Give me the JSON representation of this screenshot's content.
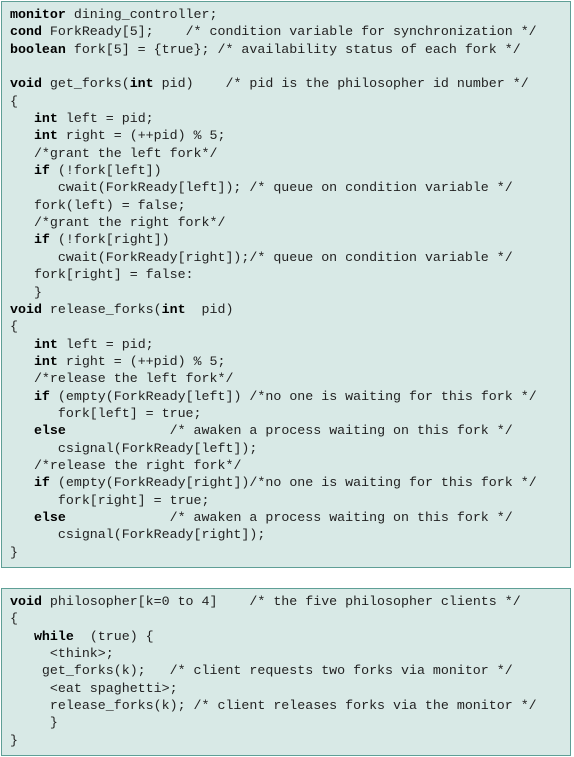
{
  "monitor_block": {
    "lines": [
      [
        {
          "t": "monitor",
          "k": "kw"
        },
        {
          "t": " dining_controller;"
        }
      ],
      [
        {
          "t": "cond",
          "k": "kw"
        },
        {
          "t": " ForkReady[5];    "
        },
        {
          "t": "/* condition variable for synchronization */",
          "k": "cm"
        }
      ],
      [
        {
          "t": "boolean",
          "k": "kw"
        },
        {
          "t": " fork[5] = {true}; "
        },
        {
          "t": "/* availability status of each fork */",
          "k": "cm"
        }
      ],
      [
        {
          "t": ""
        }
      ],
      [
        {
          "t": "void",
          "k": "kw"
        },
        {
          "t": " get_forks("
        },
        {
          "t": "int",
          "k": "kw"
        },
        {
          "t": " pid)    "
        },
        {
          "t": "/* pid is the philosopher id number */",
          "k": "cm"
        }
      ],
      [
        {
          "t": "{"
        }
      ],
      [
        {
          "t": "   "
        },
        {
          "t": "int",
          "k": "kw"
        },
        {
          "t": " left = pid;"
        }
      ],
      [
        {
          "t": "   "
        },
        {
          "t": "int",
          "k": "kw"
        },
        {
          "t": " right = (++pid) % 5;"
        }
      ],
      [
        {
          "t": "   "
        },
        {
          "t": "/*grant the left fork*/",
          "k": "cm"
        }
      ],
      [
        {
          "t": "   "
        },
        {
          "t": "if",
          "k": "kw"
        },
        {
          "t": " (!fork[left])"
        }
      ],
      [
        {
          "t": "      cwait(ForkReady[left]); "
        },
        {
          "t": "/* queue on condition variable */",
          "k": "cm"
        }
      ],
      [
        {
          "t": "   fork(left) = false;"
        }
      ],
      [
        {
          "t": "   "
        },
        {
          "t": "/*grant the right fork*/",
          "k": "cm"
        }
      ],
      [
        {
          "t": "   "
        },
        {
          "t": "if",
          "k": "kw"
        },
        {
          "t": " (!fork[right])"
        }
      ],
      [
        {
          "t": "      cwait(ForkReady[right]);"
        },
        {
          "t": "/* queue on condition variable */",
          "k": "cm"
        }
      ],
      [
        {
          "t": "   fork[right] = false:"
        }
      ],
      [
        {
          "t": "   }"
        }
      ],
      [
        {
          "t": "void",
          "k": "kw"
        },
        {
          "t": " release_forks("
        },
        {
          "t": "int",
          "k": "kw"
        },
        {
          "t": "  pid)"
        }
      ],
      [
        {
          "t": "{"
        }
      ],
      [
        {
          "t": "   "
        },
        {
          "t": "int",
          "k": "kw"
        },
        {
          "t": " left = pid;"
        }
      ],
      [
        {
          "t": "   "
        },
        {
          "t": "int",
          "k": "kw"
        },
        {
          "t": " right = (++pid) % 5;"
        }
      ],
      [
        {
          "t": "   "
        },
        {
          "t": "/*release the left fork*/",
          "k": "cm"
        }
      ],
      [
        {
          "t": "   "
        },
        {
          "t": "if",
          "k": "kw"
        },
        {
          "t": " (empty(ForkReady[left]) "
        },
        {
          "t": "/*no one is waiting for this fork */",
          "k": "cm"
        }
      ],
      [
        {
          "t": "      fork[left] = true;"
        }
      ],
      [
        {
          "t": "   "
        },
        {
          "t": "else",
          "k": "kw"
        },
        {
          "t": "             "
        },
        {
          "t": "/* awaken a process waiting on this fork */",
          "k": "cm"
        }
      ],
      [
        {
          "t": "      csignal(ForkReady[left]);"
        }
      ],
      [
        {
          "t": "   "
        },
        {
          "t": "/*release the right fork*/",
          "k": "cm"
        }
      ],
      [
        {
          "t": "   "
        },
        {
          "t": "if",
          "k": "kw"
        },
        {
          "t": " (empty(ForkReady[right])"
        },
        {
          "t": "/*no one is waiting for this fork */",
          "k": "cm"
        }
      ],
      [
        {
          "t": "      fork[right] = true;"
        }
      ],
      [
        {
          "t": "   "
        },
        {
          "t": "else",
          "k": "kw"
        },
        {
          "t": "             "
        },
        {
          "t": "/* awaken a process waiting on this fork */",
          "k": "cm"
        }
      ],
      [
        {
          "t": "      csignal(ForkReady[right]);"
        }
      ],
      [
        {
          "t": "}"
        }
      ]
    ]
  },
  "philosopher_block": {
    "lines": [
      [
        {
          "t": "void",
          "k": "kw"
        },
        {
          "t": " philosopher[k=0 to 4]    "
        },
        {
          "t": "/* the five philosopher clients */",
          "k": "cm"
        }
      ],
      [
        {
          "t": "{"
        }
      ],
      [
        {
          "t": "   "
        },
        {
          "t": "while",
          "k": "kw"
        },
        {
          "t": "  (true) {"
        }
      ],
      [
        {
          "t": "     <think>;"
        }
      ],
      [
        {
          "t": "    get_forks(k);   "
        },
        {
          "t": "/* client requests two forks via monitor */",
          "k": "cm"
        }
      ],
      [
        {
          "t": "     <eat spaghetti>;"
        }
      ],
      [
        {
          "t": "     release_forks(k); "
        },
        {
          "t": "/* client releases forks via the monitor */",
          "k": "cm"
        }
      ],
      [
        {
          "t": "     }"
        }
      ],
      [
        {
          "t": "}"
        }
      ]
    ]
  },
  "colors": {
    "box_background": "#d8e9e6",
    "box_border": "#5f9f96"
  }
}
